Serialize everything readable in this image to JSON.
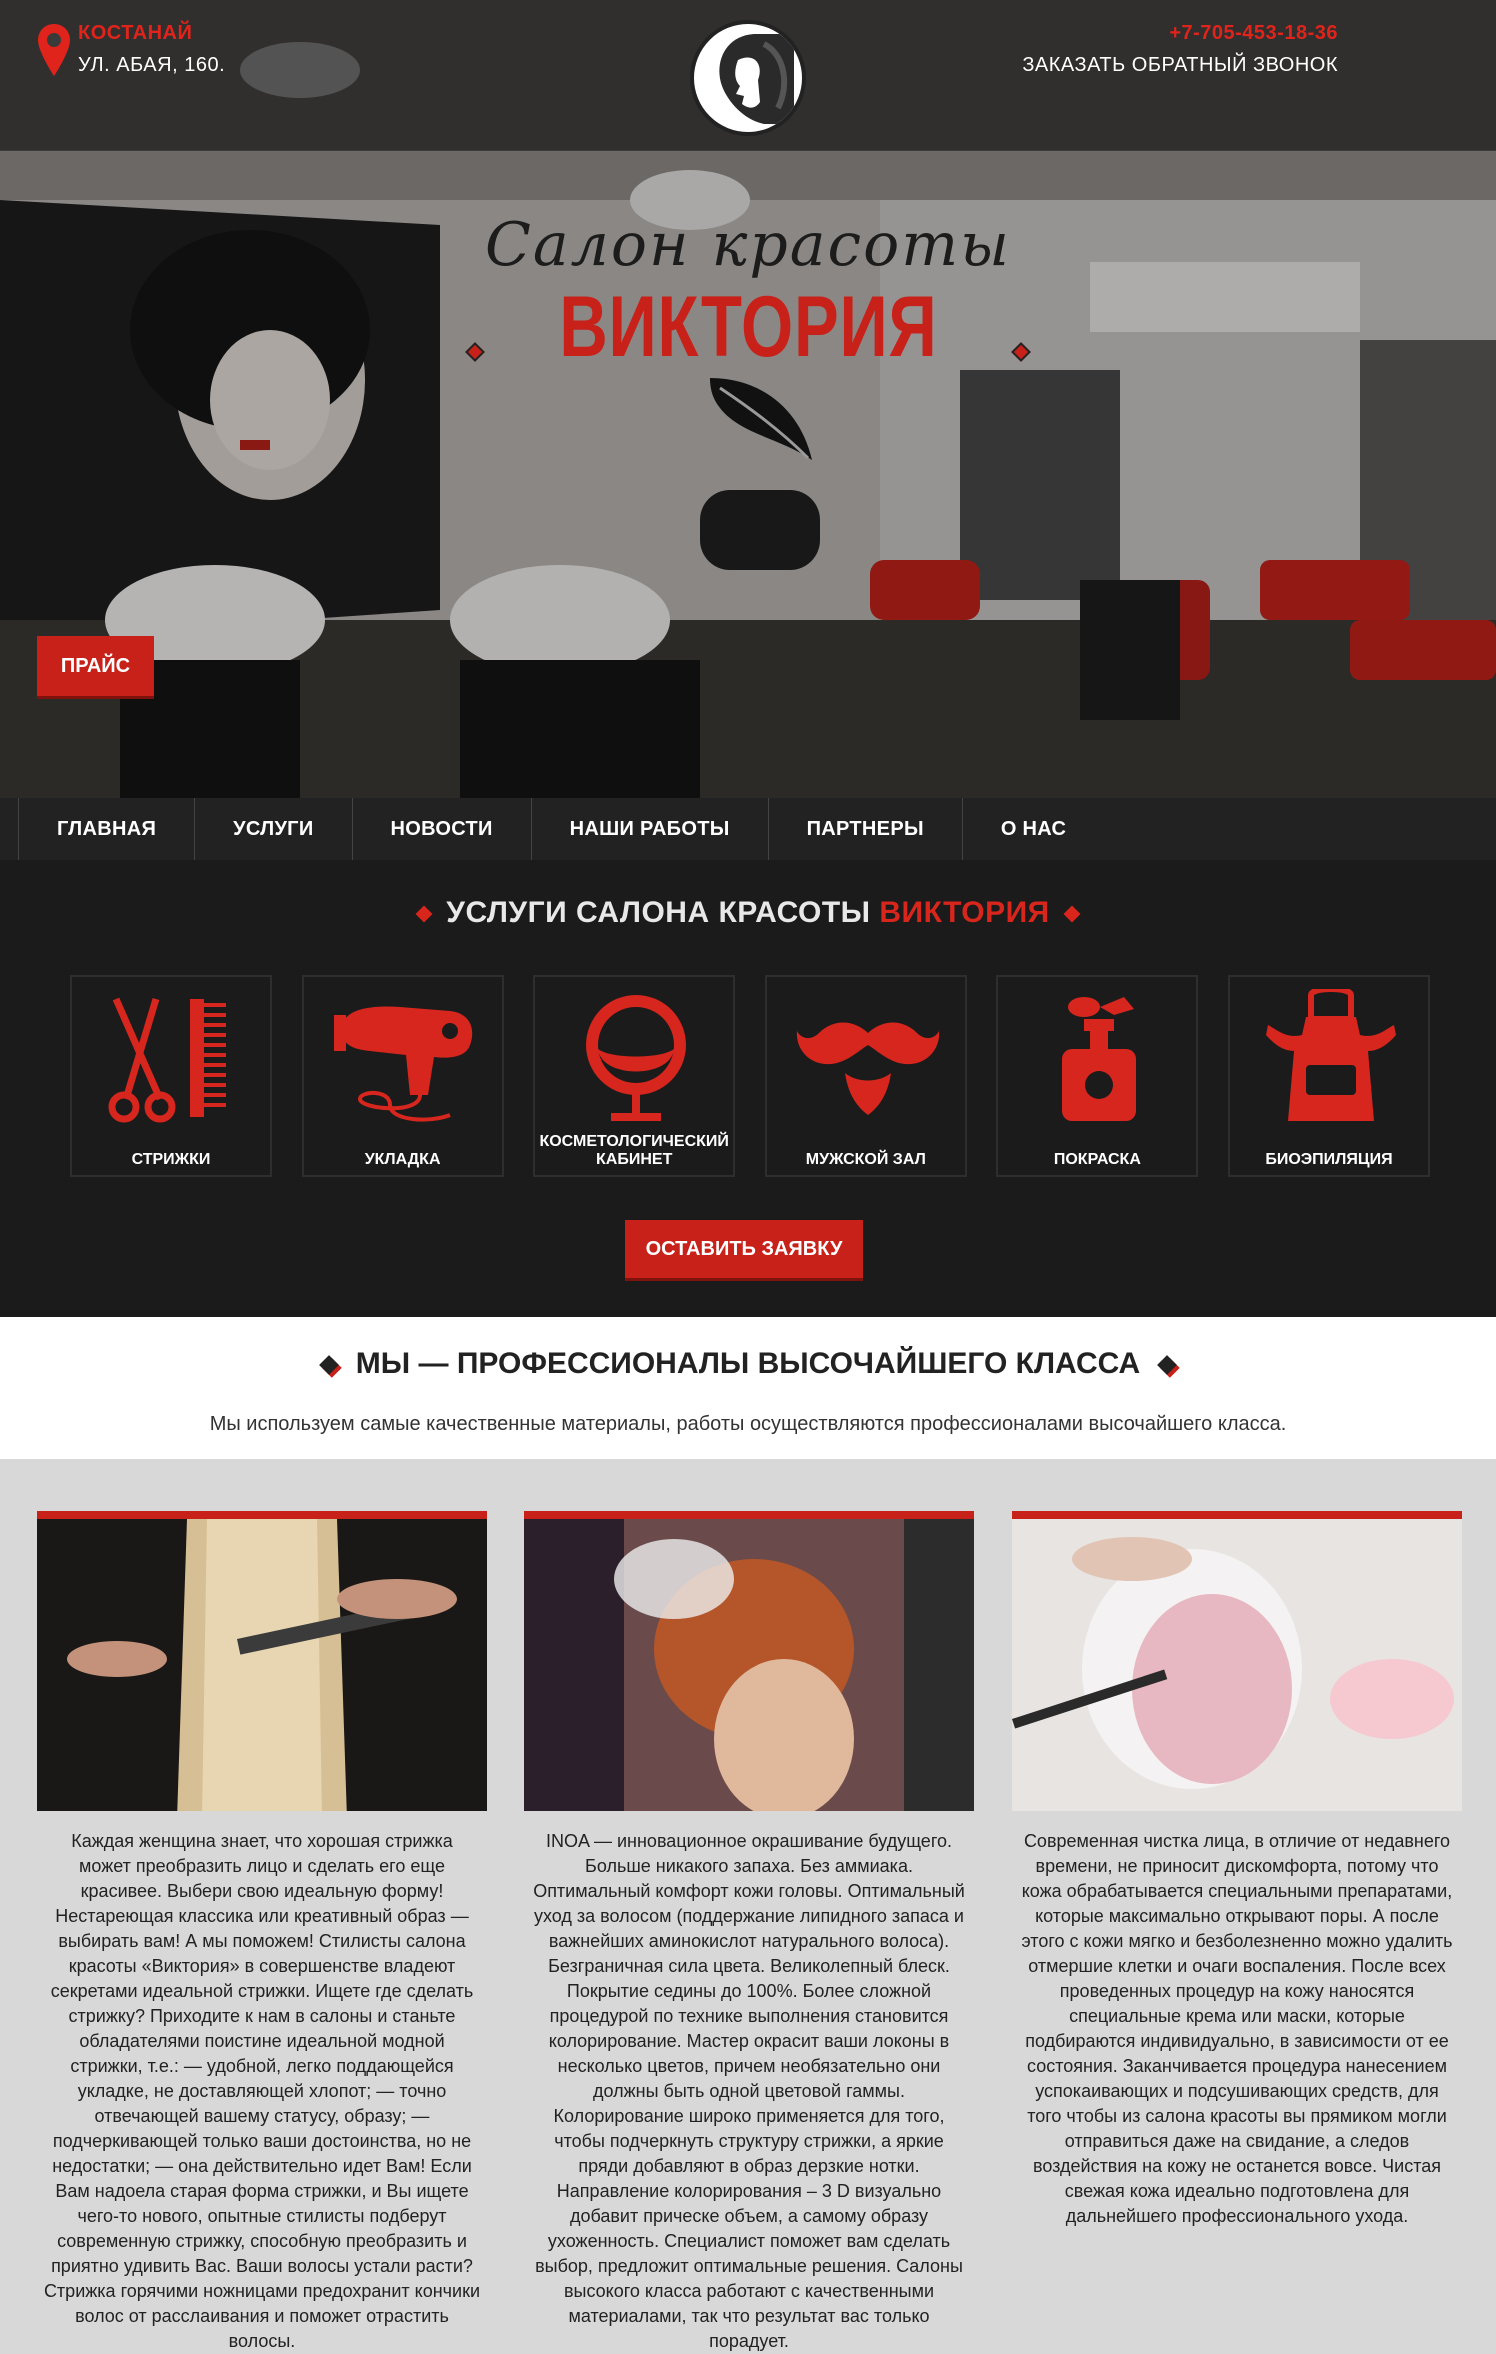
{
  "header": {
    "city": "КОСТАНАЙ",
    "street": "УЛ. АБАЯ, 160.",
    "phone": "+7-705-453-18-36",
    "callback": "ЗАКАЗАТЬ ОБРАТНЫЙ ЗВОНОК"
  },
  "hero": {
    "script_title": "Салон красоты",
    "brand": "ВИКТОРИЯ",
    "price_button": "ПРАЙС"
  },
  "nav": {
    "items": [
      "ГЛАВНАЯ",
      "УСЛУГИ",
      "НОВОСТИ",
      "НАШИ РАБОТЫ",
      "ПАРТНЕРЫ",
      "О НАС"
    ]
  },
  "services": {
    "title_main": "УСЛУГИ САЛОНА КРАСОТЫ",
    "title_brand": "ВИКТОРИЯ",
    "cards": [
      {
        "label": "СТРИЖКИ",
        "icon": "scissors-comb-icon"
      },
      {
        "label": "УКЛАДКА",
        "icon": "hair-dryer-icon"
      },
      {
        "label": "КОСМЕТОЛОГИЧЕСКИЙ КАБИНЕТ",
        "icon": "egg-chair-icon"
      },
      {
        "label": "МУЖСКОЙ ЗАЛ",
        "icon": "mustache-icon"
      },
      {
        "label": "ПОКРАСКА",
        "icon": "spray-bottle-icon"
      },
      {
        "label": "БИОЭПИЛЯЦИЯ",
        "icon": "apron-icon"
      }
    ],
    "order_button": "ОСТАВИТЬ ЗАЯВКУ"
  },
  "pro": {
    "title": "МЫ — ПРОФЕССИОНАЛЫ ВЫСОЧАЙШЕГО КЛАССА",
    "subtitle": "Мы используем самые качественные материалы, работы осуществляются профессионалами высочайшего класса."
  },
  "articles": [
    {
      "image": "haircut-photo",
      "text": "Каждая женщина знает, что хорошая стрижка может преобразить лицо и сделать его еще красивее. Выбери свою идеальную форму! Нестареющая классика или креативный образ — выбирать вам! А мы поможем! Стилисты салона красоты «Виктория» в совершенстве владеют секретами идеальной стрижки. Ищете где сделать стрижку? Приходите к нам в салоны и станьте обладателями поистине идеальной модной стрижки, т.е.: — удобной, легко поддающейся укладке, не доставляющей хлопот; — точно отвечающей вашему статусу, образу; — подчеркивающей только ваши достоинства, но не недостатки; — она действительно идет Вам! Если Вам надоела старая форма стрижки, и Вы ищете чего-то нового, опытные стилисты подберут современную стрижку, способную преобразить и приятно удивить Вас. Ваши волосы устали расти? Стрижка горячими ножницами предохранит кончики волос от расслаивания и поможет отрастить волосы."
    },
    {
      "image": "coloring-photo",
      "text": "INOA — инновационное окрашивание будущего. Больше никакого запаха. Без аммиака. Оптимальный комфорт кожи головы. Оптимальный уход за волосом (поддержание липидного запаса и важнейших аминокислот натурального волоса). Безграничная сила цвета. Великолепный блеск. Покрытие седины до 100%. Более сложной процедурой по технике выполнения становится колорирование. Мастер окрасит ваши локоны в несколько цветов, причем необязательно они должны быть одной цветовой гаммы. Колорирование широко применяется для того, чтобы подчеркнуть структуру стрижки, а яркие пряди добавляют в образ дерзкие нотки. Направление колорирования – 3 D визуально добавит прическе объем, а самому образу ухоженность. Специалист поможет вам сделать выбор, предложит оптимальные решения. Салоны высокого класса работают с качественными материалами, так что результат вас только порадует."
    },
    {
      "image": "facial-photo",
      "text": "Современная чистка лица, в отличие от недавнего времени, не приносит дискомфорта, потому что кожа обрабатывается специальными препаратами, которые максимально открывают поры. А после этого с кожи мягко и безболезненно можно удалить отмершие клетки и очаги воспаления. После всех проведенных процедур на кожу наносятся специальные крема или маски, которые подбираются индивидуально, в зависимости от ее состояния. Заканчивается процедура нанесением успокаивающих и подсушивающих средств, для того чтобы из салона красоты вы прямиком могли отправиться даже на свидание, а следов воздействия на кожу не останется вовсе. Чистая свежая кожа идеально подготовлена для дальнейшего профессионального ухода."
    }
  ],
  "colors": {
    "accent": "#c8211a",
    "dark": "#1b1b1b",
    "nav": "#222222"
  }
}
